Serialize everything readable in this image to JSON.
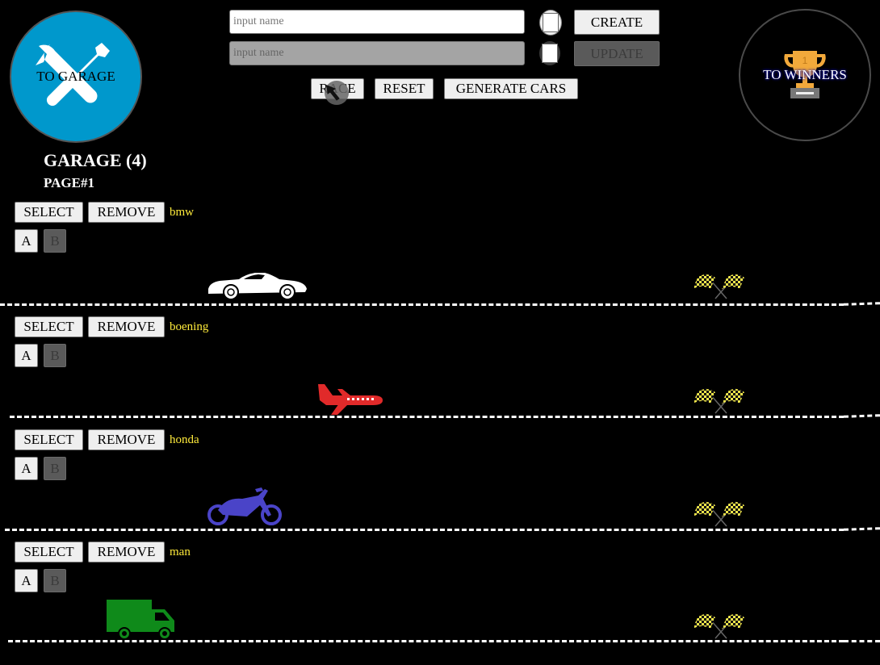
{
  "nav": {
    "garage_label": "TO GARAGE",
    "winners_label": "TO WINNERS",
    "garage_icon": "wrench-screwdriver-icon",
    "winners_icon": "trophy-icon",
    "garage_bg": "#0098cc"
  },
  "create": {
    "placeholder": "input name",
    "value": "",
    "color": "#ffffff",
    "button_label": "CREATE"
  },
  "update": {
    "placeholder": "input name",
    "value": "",
    "color": "#ffffff",
    "button_label": "UPDATE"
  },
  "controls": {
    "race_label": "RACE",
    "reset_label": "RESET",
    "generate_label": "GENERATE CARS"
  },
  "garage": {
    "title": "GARAGE (4)",
    "page": "PAGE#1"
  },
  "cars": [
    {
      "name": "bmw",
      "select_label": "SELECT",
      "remove_label": "REMOVE",
      "a_label": "A",
      "b_label": "B",
      "vehicle": "car-icon",
      "color": "#ffffff"
    },
    {
      "name": "boening",
      "select_label": "SELECT",
      "remove_label": "REMOVE",
      "a_label": "A",
      "b_label": "B",
      "vehicle": "airplane-icon",
      "color": "#e12a2a"
    },
    {
      "name": "honda",
      "select_label": "SELECT",
      "remove_label": "REMOVE",
      "a_label": "A",
      "b_label": "B",
      "vehicle": "motorcycle-icon",
      "color": "#4a44c8"
    },
    {
      "name": "man",
      "select_label": "SELECT",
      "remove_label": "REMOVE",
      "a_label": "A",
      "b_label": "B",
      "vehicle": "truck-icon",
      "color": "#0f8a1a"
    }
  ],
  "finish_icon": "checkered-flags-icon",
  "name_color": "#ffeb3b"
}
